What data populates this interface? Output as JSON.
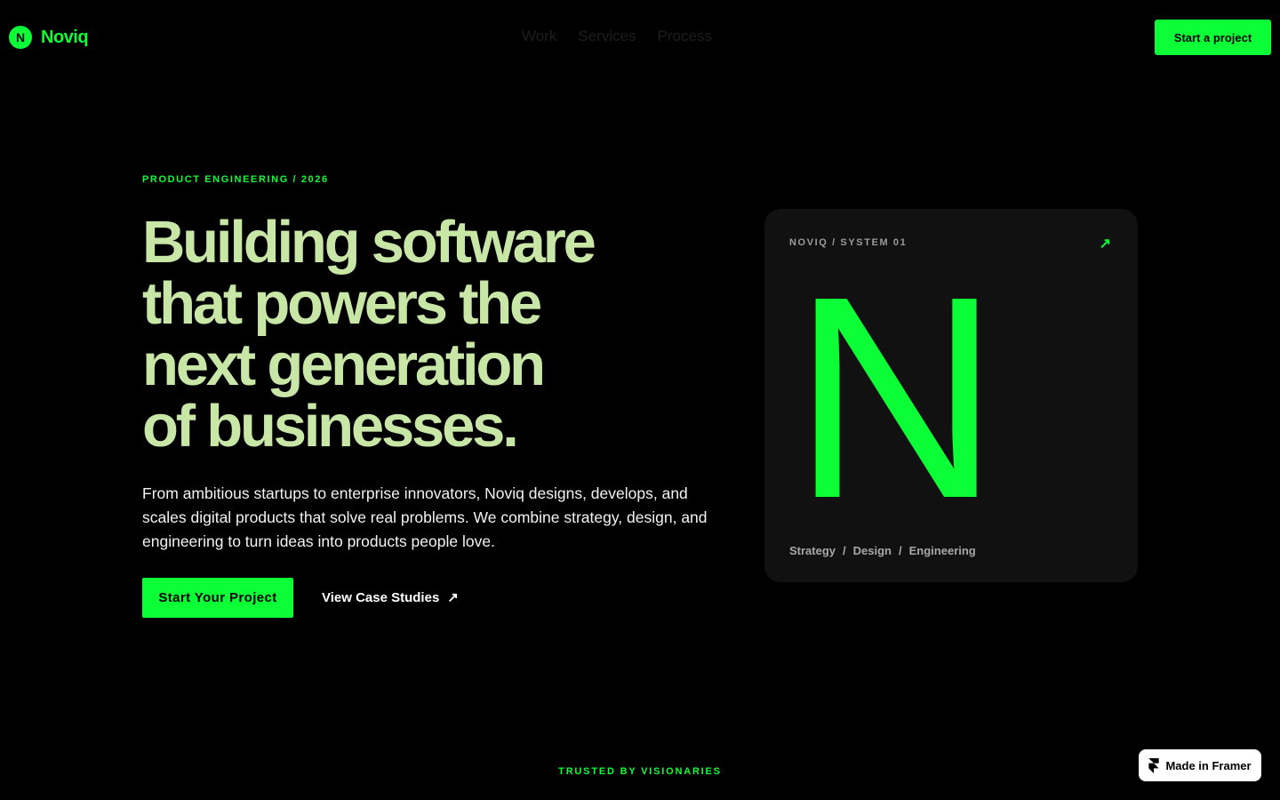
{
  "header": {
    "logo_mark": "N",
    "logo_text": "Noviq",
    "nav": [
      "Work",
      "Services",
      "Process"
    ],
    "cta": "Start a project"
  },
  "hero": {
    "eyebrow": "PRODUCT ENGINEERING / 2026",
    "headline_lines": [
      "Building software",
      "that powers the",
      "next generation",
      "of businesses."
    ],
    "description": "From ambitious startups to enterprise innovators, Noviq designs, develops, and scales digital products that solve real problems. We combine strategy, design, and engineering to turn ideas into products people love.",
    "primary_button": "Start Your Project",
    "secondary_button": "View Case Studies",
    "secondary_arrow": "↗"
  },
  "card": {
    "label": "NOVIQ / SYSTEM 01",
    "arrow": "↗",
    "letter": "N",
    "footer": [
      "Strategy",
      "/",
      "Design",
      "/",
      "Engineering"
    ]
  },
  "trusted": "TRUSTED BY VISIONARIES",
  "framer_badge": "Made in Framer",
  "colors": {
    "accent": "#0cff36",
    "headline": "#c8e6a6",
    "background": "#000000",
    "card": "#111111"
  },
  "icons": {
    "card_arrow": "arrow-up-right-icon",
    "link_arrow": "arrow-up-right-icon",
    "badge": "framer-logo-icon"
  }
}
